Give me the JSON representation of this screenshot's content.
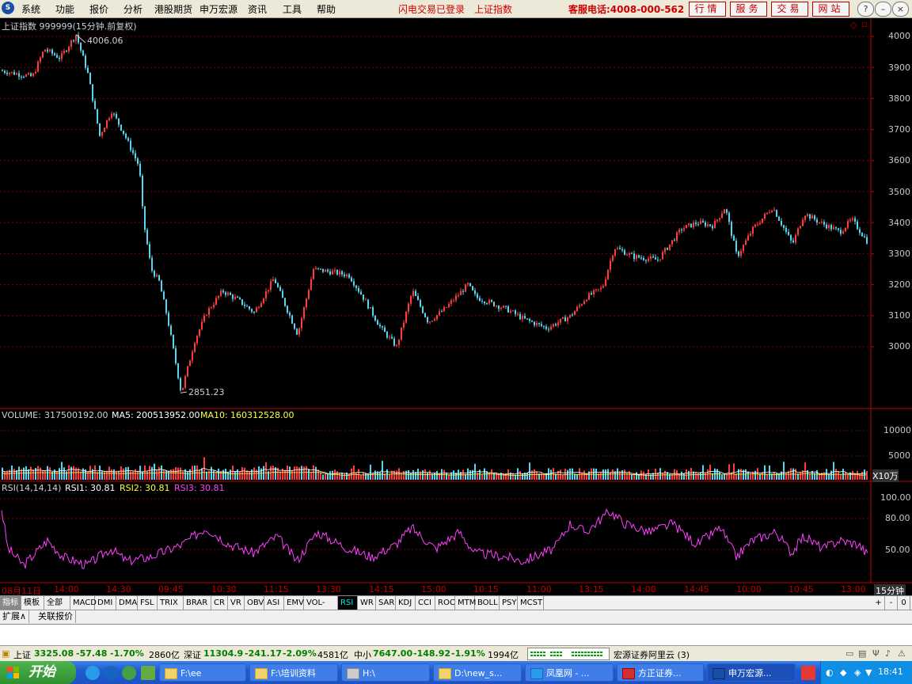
{
  "menu": {
    "items": [
      "系统",
      "功能",
      "报价",
      "分析",
      "港股期货",
      "申万宏源",
      "资讯",
      "工具",
      "帮助"
    ],
    "status_login": "闪电交易已登录",
    "status_index": "上证指数",
    "hotline": "客服电话:4008-000-562",
    "right_buttons": [
      "行情",
      "服务",
      "交易",
      "网站"
    ]
  },
  "chart": {
    "title": "上证指数  999999(15分钟.前复权)",
    "price_high_label": "4006.06",
    "price_low_label": "2851.23",
    "price_ticks": [
      "4000",
      "3900",
      "3800",
      "3700",
      "3600",
      "3500",
      "3400",
      "3300",
      "3200",
      "3100",
      "3000"
    ],
    "volume": {
      "label": "VOLUME:",
      "value": "317500192.00",
      "ma5_label": "MA5:",
      "ma5_value": "200513952.00",
      "ma10_label": "MA10:",
      "ma10_value": "160312528.00",
      "ticks": [
        "10000",
        "5000"
      ],
      "unit": "X10万"
    },
    "rsi": {
      "label": "RSI(14,14,14)",
      "rsi1_label": "RSI1:",
      "rsi1_value": "30.81",
      "rsi2_label": "RSI2:",
      "rsi2_value": "30.81",
      "rsi3_label": "RSI3:",
      "rsi3_value": "30.81",
      "ticks": [
        "100.00",
        "80.00",
        "50.00"
      ]
    },
    "time_axis": [
      "08月11日",
      "14:00",
      "14:30",
      "09:45",
      "10:30",
      "11:15",
      "13:30",
      "14:15",
      "15:00",
      "10:15",
      "11:00",
      "13:15",
      "14:00",
      "14:45",
      "10:00",
      "10:45",
      "13:00"
    ],
    "period": "15分钟",
    "colors": {
      "up": "#ff3b3b",
      "down": "#56d6f0",
      "rsi": "#ff40ff",
      "ma5": "#ffffff",
      "ma10": "#ffff40",
      "grid": "#800000",
      "axis": "#c00000"
    }
  },
  "indicator_tabs": [
    "指标",
    "模板",
    "全部",
    "MACD",
    "DMI",
    "DMA",
    "FSL",
    "TRIX",
    "BRAR",
    "CR",
    "VR",
    "OBV",
    "ASI",
    "EMV",
    "VOL-TDX",
    "RSI",
    "WR",
    "SAR",
    "KDJ",
    "CCI",
    "ROC",
    "MTM",
    "BOLL",
    "PSY",
    "MCST"
  ],
  "active_tab": "RSI",
  "zoom_buttons": [
    "+",
    "-",
    "0"
  ],
  "ext_tabs": [
    "扩展∧",
    "关联报价"
  ],
  "index_bar": {
    "sh_name": "上证",
    "sh_value": "3325.08",
    "sh_change": "-57.48",
    "sh_pct": "-1.70%",
    "sh_amount": "2860亿",
    "sz_name": "深证",
    "sz_value": "11304.9",
    "sz_change": "-241.17",
    "sz_pct": "-2.09%",
    "sz_amount": "4581亿",
    "zx_name": "中小",
    "zx_value": "7647.00",
    "zx_change": "-148.92",
    "zx_pct": "-1.91%",
    "zx_amount": "1994亿",
    "broker": "宏源证券阿里云 (3)"
  },
  "taskbar": {
    "start": "开始",
    "items": [
      "F:\\ee",
      "F:\\培训资料",
      "H:\\",
      "D:\\new_s...",
      "凤凰网 - ...",
      "方正证券...",
      "申万宏源..."
    ],
    "clock": "18:41"
  }
}
